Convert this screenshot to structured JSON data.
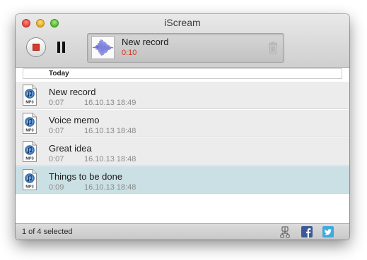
{
  "window": {
    "title": "iScream"
  },
  "toolbar": {
    "stop_icon": "stop-record-icon",
    "pause_icon": "pause-icon",
    "current_record": {
      "name": "New record",
      "time": "0:10",
      "time_color": "#d8341f"
    },
    "trash_icon": "trash-icon"
  },
  "list": {
    "section": "Today",
    "items": [
      {
        "title": "New record",
        "duration": "0:07",
        "date": "16.10.13 18:49",
        "icon": "mp3-file-icon",
        "selected": false
      },
      {
        "title": "Voice memo",
        "duration": "0:07",
        "date": "16.10.13 18:48",
        "icon": "mp3-file-icon",
        "selected": false
      },
      {
        "title": "Great idea",
        "duration": "0:07",
        "date": "16.10.13 18:48",
        "icon": "mp3-file-icon",
        "selected": false
      },
      {
        "title": "Things to be done",
        "duration": "0:09",
        "date": "16.10.13 18:48",
        "icon": "mp3-file-icon",
        "selected": true
      }
    ]
  },
  "statusbar": {
    "text": "1 of 4 selected",
    "icons": [
      "share-icon",
      "facebook-icon",
      "twitter-icon"
    ]
  },
  "colors": {
    "selection": "#cbe0e4",
    "facebook": "#3b5998",
    "twitter": "#3fa9e0",
    "stop_red": "#d93a2a"
  }
}
